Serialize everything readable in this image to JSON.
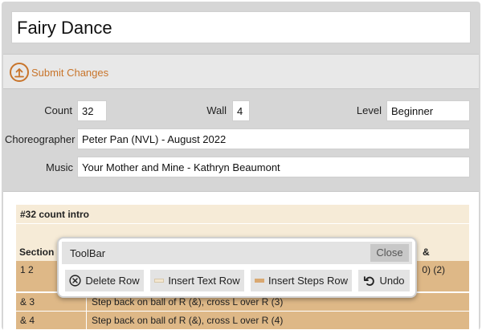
{
  "dance": {
    "title": "Fairy Dance"
  },
  "submit": {
    "label": "Submit Changes",
    "icon": "upload-icon"
  },
  "fields": {
    "count_label": "Count",
    "count_value": "32",
    "wall_label": "Wall",
    "wall_value": "4",
    "level_label": "Level",
    "level_value": "Beginner",
    "choreographer_label": "Choreographer",
    "choreographer_value": "Peter Pan (NVL) - August 2022",
    "music_label": "Music",
    "music_value": "Your Mother and Mine - Kathryn Beaumont"
  },
  "sheet": {
    "intro": "#32 count intro",
    "header_section": "Section",
    "header_tail": "&",
    "rows": [
      {
        "count": "1 2",
        "desc": "0) (2)"
      },
      {
        "count": "& 3",
        "desc": "Step back on ball of R (&), cross L over R (3)"
      },
      {
        "count": "& 4",
        "desc": "Step back on ball of R (&), cross L over R (4)"
      }
    ]
  },
  "toolbar": {
    "title": "ToolBar",
    "close_label": "Close",
    "delete_row_label": "Delete Row",
    "insert_text_row_label": "Insert Text Row",
    "insert_steps_row_label": "Insert Steps Row",
    "undo_label": "Undo"
  },
  "colors": {
    "accent": "#c8742a",
    "step_row": "#deb887",
    "text_row": "#f6ebd7"
  }
}
